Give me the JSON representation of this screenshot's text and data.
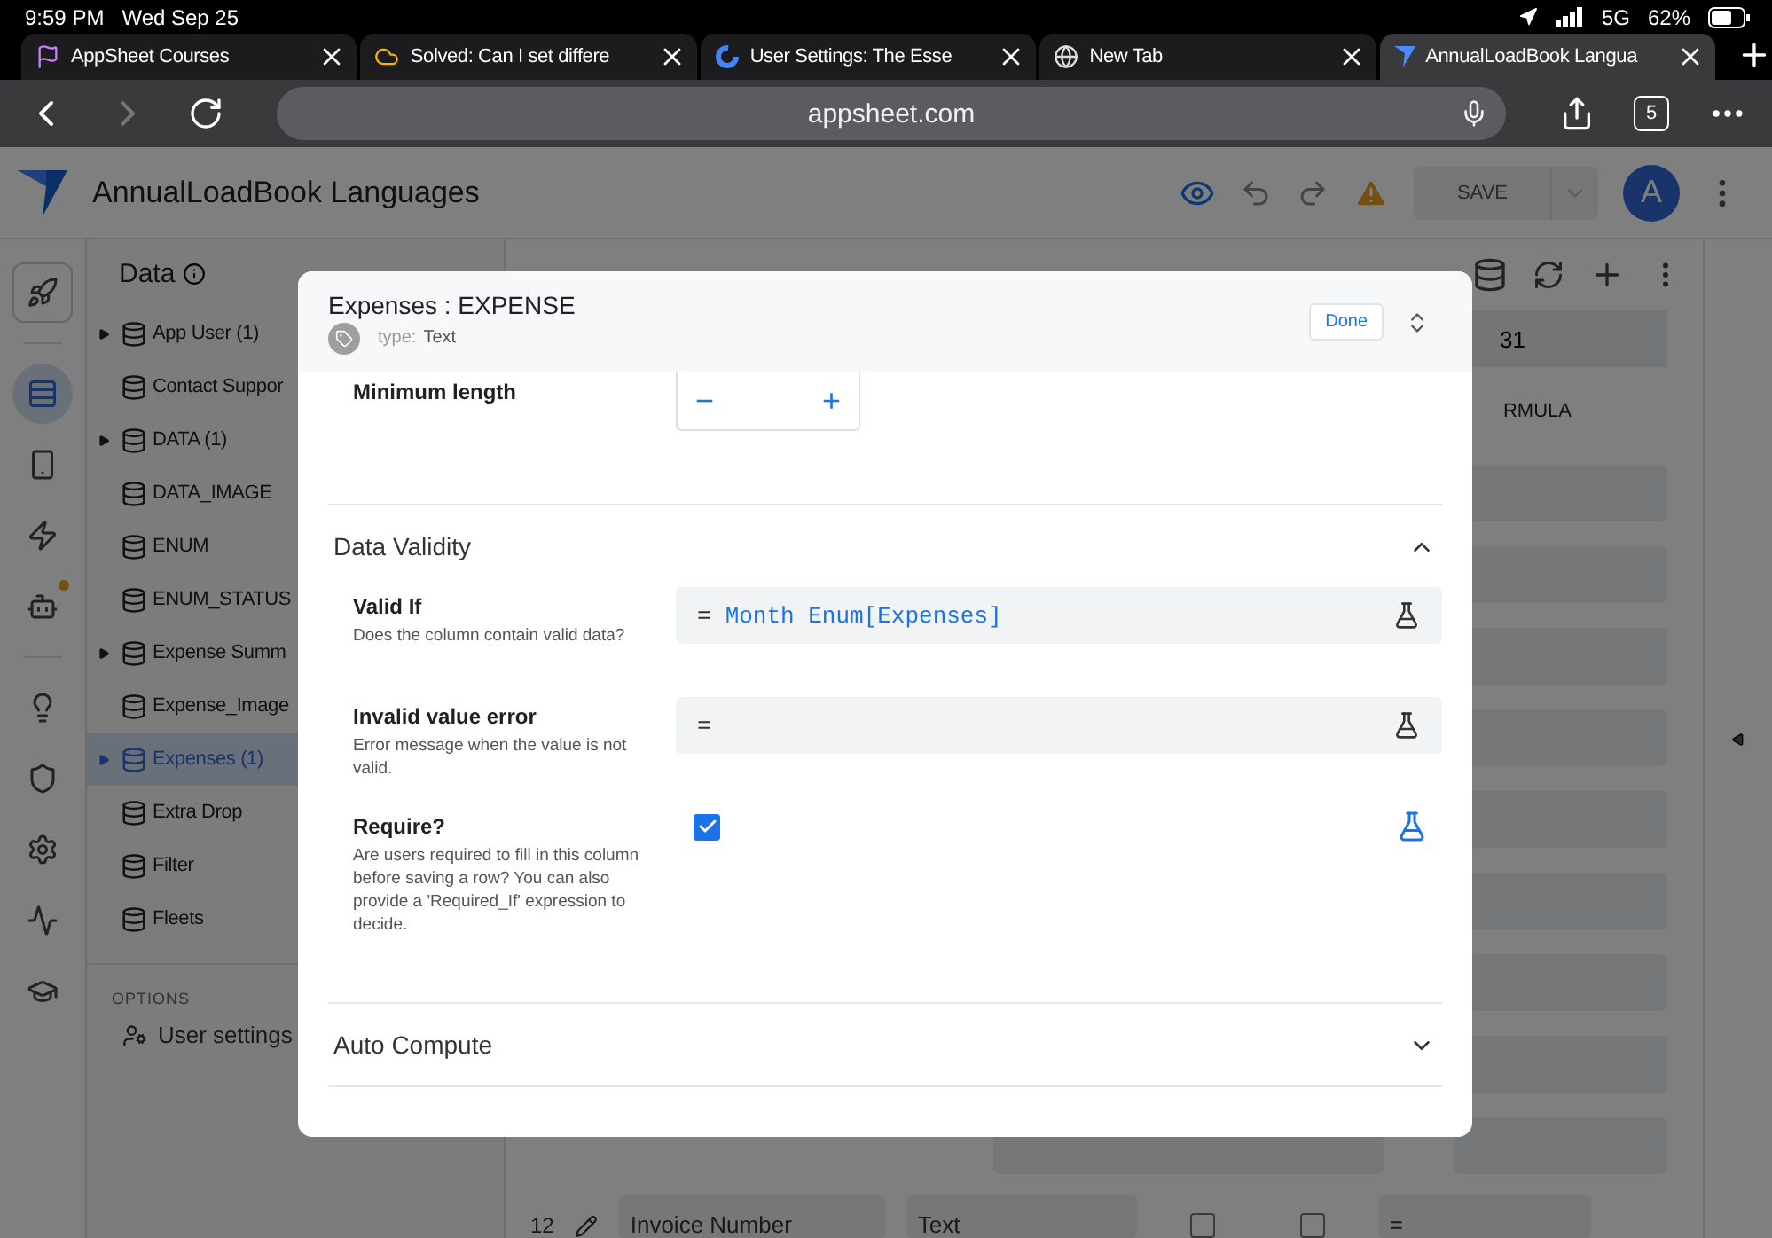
{
  "status_bar": {
    "time": "9:59 PM",
    "date": "Wed Sep 25",
    "network": "5G",
    "battery": "62%"
  },
  "browser_tabs": [
    {
      "kind": "flag",
      "title": "AppSheet Courses",
      "selected": false
    },
    {
      "kind": "cloud",
      "title": "Solved: Can I set differe",
      "selected": false
    },
    {
      "kind": "google",
      "title": "User Settings: The Esse",
      "selected": false
    },
    {
      "kind": "globe",
      "title": "New Tab",
      "selected": false
    },
    {
      "kind": "appsheet",
      "title": "AnnualLoadBook Langua",
      "selected": true
    }
  ],
  "address_bar": {
    "url": "appsheet.com",
    "tab_count": "5"
  },
  "app": {
    "title": "AnnualLoadBook Languages",
    "save_label": "SAVE",
    "avatar": "A"
  },
  "rail": [
    {
      "kind": "rocket",
      "selected": false,
      "notification": false
    },
    {
      "kind": "data",
      "selected": true,
      "notification": false
    },
    {
      "kind": "phone",
      "selected": false,
      "notification": false
    },
    {
      "kind": "bolt",
      "selected": false,
      "notification": false
    },
    {
      "kind": "robot",
      "selected": false,
      "notification": true
    },
    {
      "kind": "bulb",
      "selected": false,
      "notification": false
    },
    {
      "kind": "shield",
      "selected": false,
      "notification": false
    },
    {
      "kind": "gear",
      "selected": false,
      "notification": false
    },
    {
      "kind": "monitor",
      "selected": false,
      "notification": false
    },
    {
      "kind": "cap",
      "selected": false,
      "notification": false
    }
  ],
  "sidebar": {
    "title": "Data",
    "tables": [
      {
        "name": "App User (1)",
        "expandable": true,
        "selected": false
      },
      {
        "name": "Contact Suppor",
        "expandable": false,
        "selected": false
      },
      {
        "name": "DATA (1)",
        "expandable": true,
        "selected": false
      },
      {
        "name": "DATA_IMAGE",
        "expandable": false,
        "selected": false
      },
      {
        "name": "ENUM",
        "expandable": false,
        "selected": false
      },
      {
        "name": "ENUM_STATUS",
        "expandable": false,
        "selected": false
      },
      {
        "name": "Expense Summ",
        "expandable": true,
        "selected": false
      },
      {
        "name": "Expense_Image",
        "expandable": false,
        "selected": false
      },
      {
        "name": "Expenses (1)",
        "expandable": true,
        "selected": true
      },
      {
        "name": "Extra Drop",
        "expandable": false,
        "selected": false
      },
      {
        "name": "Filter",
        "expandable": false,
        "selected": false
      },
      {
        "name": "Fleets",
        "expandable": false,
        "selected": false
      }
    ],
    "options_heading": "OPTIONS",
    "options": [
      {
        "label": "User settings"
      }
    ]
  },
  "table_view": {
    "row_count": "31",
    "column_heading": "RMULA",
    "last_row": {
      "number": "12",
      "name": "Invoice Number",
      "type": "Text",
      "flags": [
        {
          "checked": false
        },
        {
          "checked": false
        }
      ],
      "formula": "="
    }
  },
  "dialog": {
    "title": "Expenses : EXPENSE",
    "type_label": "type:",
    "type_value": "Text",
    "done": "Done",
    "min_length": {
      "label": "Minimum length",
      "minus": "−",
      "plus": "+"
    },
    "sections": [
      {
        "title": "Data Validity",
        "expanded": true,
        "fields": [
          {
            "kind": "formula",
            "label": "Valid If",
            "description": "Does the column contain valid data?",
            "prefix": "=",
            "formula": "Month Enum[Expenses]"
          },
          {
            "kind": "formula",
            "label": "Invalid value error",
            "description": "Error message when the value is not valid.",
            "prefix": "="
          },
          {
            "kind": "checkbox",
            "label": "Require?",
            "description": "Are users required to fill in this column before saving a row? You can also provide a 'Required_If' expression to decide.",
            "checked": true
          }
        ]
      },
      {
        "title": "Auto Compute",
        "expanded": false
      }
    ]
  }
}
